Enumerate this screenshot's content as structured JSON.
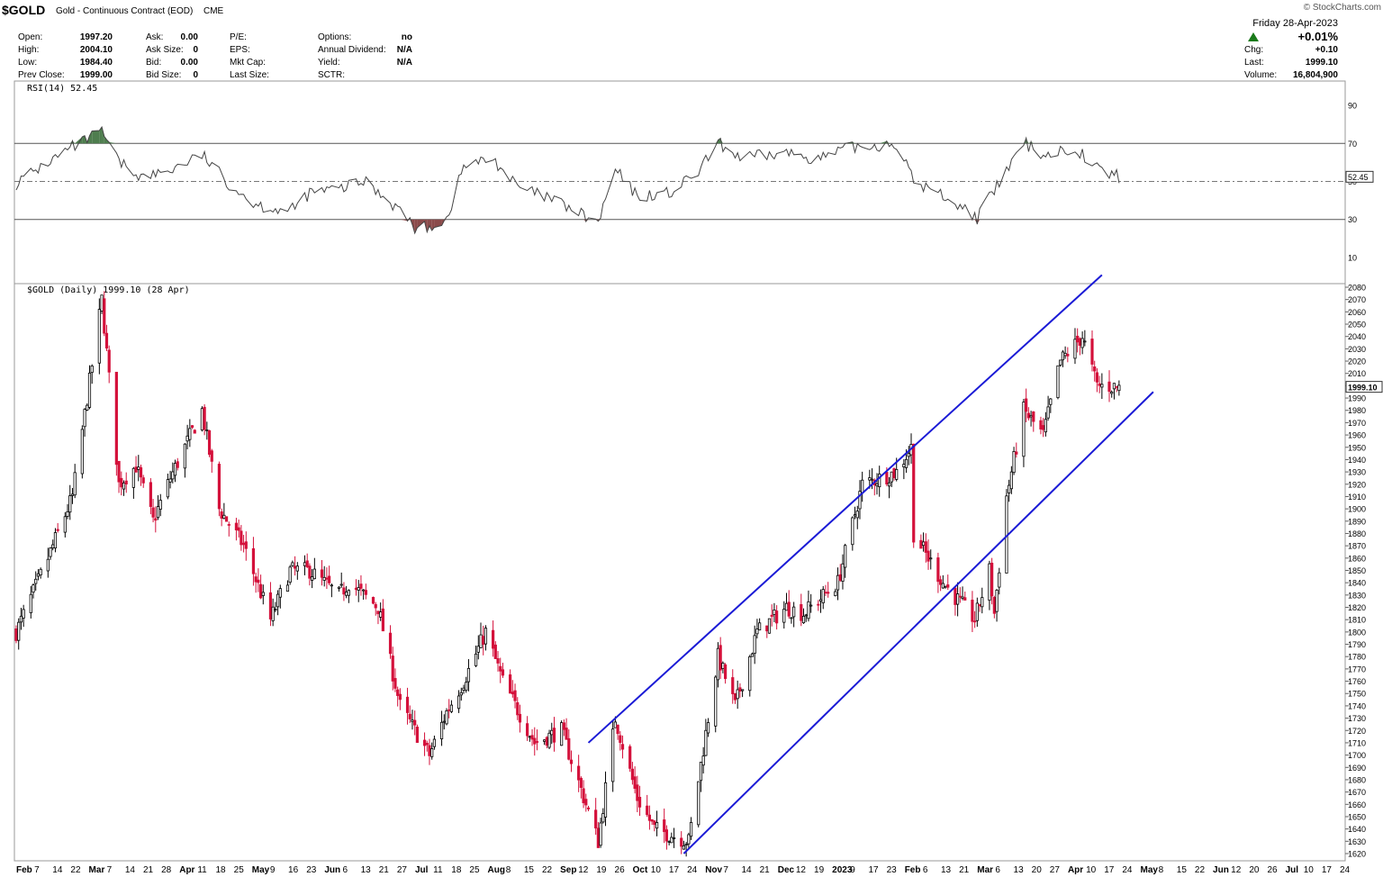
{
  "header": {
    "symbol": "$GOLD",
    "name": "Gold - Continuous Contract (EOD)",
    "exchange": "CME",
    "watermark": "© StockCharts.com",
    "date_line": "Friday  28-Apr-2023",
    "change_pct": "+0.01%",
    "up_arrow_color": "#1a7a1a",
    "quote": [
      {
        "label": "Open:",
        "value": "1997.20"
      },
      {
        "label": "High:",
        "value": "2004.10"
      },
      {
        "label": "Low:",
        "value": "1984.40"
      },
      {
        "label": "Prev Close:",
        "value": "1999.00"
      }
    ],
    "quote2": [
      {
        "label": "Ask:",
        "value": "0.00"
      },
      {
        "label": "Ask Size:",
        "value": "0"
      },
      {
        "label": "Bid:",
        "value": "0.00"
      },
      {
        "label": "Bid Size:",
        "value": "0"
      }
    ],
    "fund": [
      {
        "label": "P/E:",
        "value": ""
      },
      {
        "label": "EPS:",
        "value": ""
      },
      {
        "label": "Mkt Cap:",
        "value": ""
      },
      {
        "label": "Last Size:",
        "value": ""
      }
    ],
    "opts": [
      {
        "label": "Options:",
        "value": "no"
      },
      {
        "label": "Annual Dividend:",
        "value": "N/A"
      },
      {
        "label": "Yield:",
        "value": "N/A"
      },
      {
        "label": "SCTR:",
        "value": ""
      }
    ],
    "right": [
      {
        "label": "Chg:",
        "value": "+0.10"
      },
      {
        "label": "Last:",
        "value": "1999.10"
      },
      {
        "label": "Volume:",
        "value": "16,804,900"
      }
    ]
  },
  "rsi_panel": {
    "label": "RSI(14) 52.45",
    "current": "52.45",
    "levels": [
      90,
      70,
      50,
      30,
      10
    ],
    "overbought": 70,
    "oversold": 30
  },
  "price_panel": {
    "label": "$GOLD (Daily) 1999.10 (28 Apr)",
    "last_tag": "1999.10"
  },
  "colors": {
    "up": "#000000",
    "down": "#d4113b",
    "trendline": "#1b1bd6",
    "rsi_line": "#444444",
    "overbought_fill": "#4e7d4e",
    "oversold_fill": "#8a4a4a"
  },
  "x_axis": [
    {
      "label": "Feb",
      "bold": true
    },
    {
      "label": "7",
      "bold": false
    },
    {
      "label": "14",
      "bold": false
    },
    {
      "label": "22",
      "bold": false
    },
    {
      "label": "Mar",
      "bold": true
    },
    {
      "label": "7",
      "bold": false
    },
    {
      "label": "14",
      "bold": false
    },
    {
      "label": "21",
      "bold": false
    },
    {
      "label": "28",
      "bold": false
    },
    {
      "label": "Apr",
      "bold": true
    },
    {
      "label": "11",
      "bold": false
    },
    {
      "label": "18",
      "bold": false
    },
    {
      "label": "25",
      "bold": false
    },
    {
      "label": "May",
      "bold": true
    },
    {
      "label": "9",
      "bold": false
    },
    {
      "label": "16",
      "bold": false
    },
    {
      "label": "23",
      "bold": false
    },
    {
      "label": "Jun",
      "bold": true
    },
    {
      "label": "6",
      "bold": false
    },
    {
      "label": "13",
      "bold": false
    },
    {
      "label": "21",
      "bold": false
    },
    {
      "label": "27",
      "bold": false
    },
    {
      "label": "Jul",
      "bold": true
    },
    {
      "label": "11",
      "bold": false
    },
    {
      "label": "18",
      "bold": false
    },
    {
      "label": "25",
      "bold": false
    },
    {
      "label": "Aug",
      "bold": true
    },
    {
      "label": "8",
      "bold": false
    },
    {
      "label": "15",
      "bold": false
    },
    {
      "label": "22",
      "bold": false
    },
    {
      "label": "Sep",
      "bold": true
    },
    {
      "label": "12",
      "bold": false
    },
    {
      "label": "19",
      "bold": false
    },
    {
      "label": "26",
      "bold": false
    },
    {
      "label": "Oct",
      "bold": true
    },
    {
      "label": "10",
      "bold": false
    },
    {
      "label": "17",
      "bold": false
    },
    {
      "label": "24",
      "bold": false
    },
    {
      "label": "Nov",
      "bold": true
    },
    {
      "label": "7",
      "bold": false
    },
    {
      "label": "14",
      "bold": false
    },
    {
      "label": "21",
      "bold": false
    },
    {
      "label": "Dec",
      "bold": true
    },
    {
      "label": "12",
      "bold": false
    },
    {
      "label": "19",
      "bold": false
    },
    {
      "label": "2023",
      "bold": true
    },
    {
      "label": "9",
      "bold": false
    },
    {
      "label": "17",
      "bold": false
    },
    {
      "label": "23",
      "bold": false
    },
    {
      "label": "Feb",
      "bold": true
    },
    {
      "label": "6",
      "bold": false
    },
    {
      "label": "13",
      "bold": false
    },
    {
      "label": "21",
      "bold": false
    },
    {
      "label": "Mar",
      "bold": true
    },
    {
      "label": "6",
      "bold": false
    },
    {
      "label": "13",
      "bold": false
    },
    {
      "label": "20",
      "bold": false
    },
    {
      "label": "27",
      "bold": false
    },
    {
      "label": "Apr",
      "bold": true
    },
    {
      "label": "10",
      "bold": false
    },
    {
      "label": "17",
      "bold": false
    },
    {
      "label": "24",
      "bold": false
    },
    {
      "label": "May",
      "bold": true
    },
    {
      "label": "8",
      "bold": false
    },
    {
      "label": "15",
      "bold": false
    },
    {
      "label": "22",
      "bold": false
    },
    {
      "label": "Jun",
      "bold": true
    },
    {
      "label": "12",
      "bold": false
    },
    {
      "label": "20",
      "bold": false
    },
    {
      "label": "26",
      "bold": false
    },
    {
      "label": "Jul",
      "bold": true
    },
    {
      "label": "10",
      "bold": false
    },
    {
      "label": "17",
      "bold": false
    },
    {
      "label": "24",
      "bold": false
    }
  ],
  "chart_data": {
    "type": "candlestick",
    "title": "$GOLD (Daily) 1999.10 (28 Apr)",
    "date_range": [
      "2022-02-01",
      "2023-04-28"
    ],
    "ylim": [
      1620,
      2080
    ],
    "y_ticks": [
      1620,
      1630,
      1640,
      1650,
      1660,
      1670,
      1680,
      1690,
      1700,
      1710,
      1720,
      1730,
      1740,
      1750,
      1760,
      1770,
      1780,
      1790,
      1800,
      1810,
      1820,
      1830,
      1840,
      1850,
      1860,
      1870,
      1880,
      1890,
      1900,
      1910,
      1920,
      1930,
      1940,
      1950,
      1960,
      1970,
      1980,
      1990,
      2000,
      2010,
      2020,
      2030,
      2040,
      2050,
      2060,
      2070,
      2080
    ],
    "price_path": [
      [
        "2022-02-01",
        1800
      ],
      [
        "2022-02-14",
        1860
      ],
      [
        "2022-02-24",
        1910
      ],
      [
        "2022-03-08",
        2070
      ],
      [
        "2022-03-15",
        1920
      ],
      [
        "2022-03-22",
        1935
      ],
      [
        "2022-03-29",
        1890
      ],
      [
        "2022-04-05",
        1925
      ],
      [
        "2022-04-18",
        1980
      ],
      [
        "2022-04-25",
        1900
      ],
      [
        "2022-05-05",
        1870
      ],
      [
        "2022-05-16",
        1810
      ],
      [
        "2022-05-24",
        1850
      ],
      [
        "2022-06-01",
        1850
      ],
      [
        "2022-06-13",
        1830
      ],
      [
        "2022-06-17",
        1840
      ],
      [
        "2022-06-29",
        1820
      ],
      [
        "2022-07-08",
        1740
      ],
      [
        "2022-07-20",
        1700
      ],
      [
        "2022-07-27",
        1735
      ],
      [
        "2022-08-03",
        1760
      ],
      [
        "2022-08-12",
        1800
      ],
      [
        "2022-08-19",
        1760
      ],
      [
        "2022-09-01",
        1710
      ],
      [
        "2022-09-12",
        1720
      ],
      [
        "2022-09-27",
        1630
      ],
      [
        "2022-10-04",
        1730
      ],
      [
        "2022-10-13",
        1665
      ],
      [
        "2022-10-20",
        1640
      ],
      [
        "2022-11-03",
        1630
      ],
      [
        "2022-11-07",
        1680
      ],
      [
        "2022-11-15",
        1780
      ],
      [
        "2022-11-22",
        1740
      ],
      [
        "2022-12-01",
        1800
      ],
      [
        "2022-12-13",
        1820
      ],
      [
        "2022-12-20",
        1815
      ],
      [
        "2023-01-03",
        1840
      ],
      [
        "2023-01-13",
        1920
      ],
      [
        "2023-01-27",
        1930
      ],
      [
        "2023-02-02",
        1950
      ],
      [
        "2023-02-03",
        1880
      ],
      [
        "2023-02-15",
        1840
      ],
      [
        "2023-02-28",
        1810
      ],
      [
        "2023-03-06",
        1850
      ],
      [
        "2023-03-08",
        1815
      ],
      [
        "2023-03-13",
        1910
      ],
      [
        "2023-03-20",
        1980
      ],
      [
        "2023-03-28",
        1960
      ],
      [
        "2023-04-04",
        2020
      ],
      [
        "2023-04-13",
        2040
      ],
      [
        "2023-04-19",
        2000
      ],
      [
        "2023-04-28",
        1999.1
      ]
    ],
    "channel_upper": [
      [
        "2022-09-23",
        1710
      ],
      [
        "2023-04-21",
        2090
      ]
    ],
    "channel_lower": [
      [
        "2022-11-01",
        1620
      ],
      [
        "2023-05-12",
        1995
      ]
    ],
    "rsi_path": [
      [
        "2022-02-01",
        49
      ],
      [
        "2022-02-14",
        60
      ],
      [
        "2022-02-24",
        68
      ],
      [
        "2022-03-08",
        76
      ],
      [
        "2022-03-15",
        60
      ],
      [
        "2022-03-25",
        52
      ],
      [
        "2022-04-05",
        56
      ],
      [
        "2022-04-18",
        64
      ],
      [
        "2022-04-28",
        50
      ],
      [
        "2022-05-10",
        38
      ],
      [
        "2022-05-24",
        34
      ],
      [
        "2022-06-01",
        44
      ],
      [
        "2022-06-13",
        46
      ],
      [
        "2022-06-24",
        50
      ],
      [
        "2022-07-08",
        35
      ],
      [
        "2022-07-15",
        24
      ],
      [
        "2022-07-27",
        30
      ],
      [
        "2022-08-03",
        58
      ],
      [
        "2022-08-15",
        62
      ],
      [
        "2022-08-25",
        47
      ],
      [
        "2022-09-09",
        40
      ],
      [
        "2022-09-27",
        28
      ],
      [
        "2022-10-04",
        56
      ],
      [
        "2022-10-13",
        42
      ],
      [
        "2022-10-27",
        44
      ],
      [
        "2022-11-07",
        55
      ],
      [
        "2022-11-15",
        70
      ],
      [
        "2022-11-25",
        62
      ],
      [
        "2022-12-13",
        65
      ],
      [
        "2022-12-27",
        62
      ],
      [
        "2023-01-09",
        68
      ],
      [
        "2023-01-27",
        70
      ],
      [
        "2023-02-03",
        50
      ],
      [
        "2023-02-16",
        42
      ],
      [
        "2023-03-01",
        31
      ],
      [
        "2023-03-08",
        45
      ],
      [
        "2023-03-20",
        70
      ],
      [
        "2023-03-29",
        64
      ],
      [
        "2023-04-10",
        68
      ],
      [
        "2023-04-20",
        56
      ],
      [
        "2023-04-28",
        52.45
      ]
    ]
  }
}
